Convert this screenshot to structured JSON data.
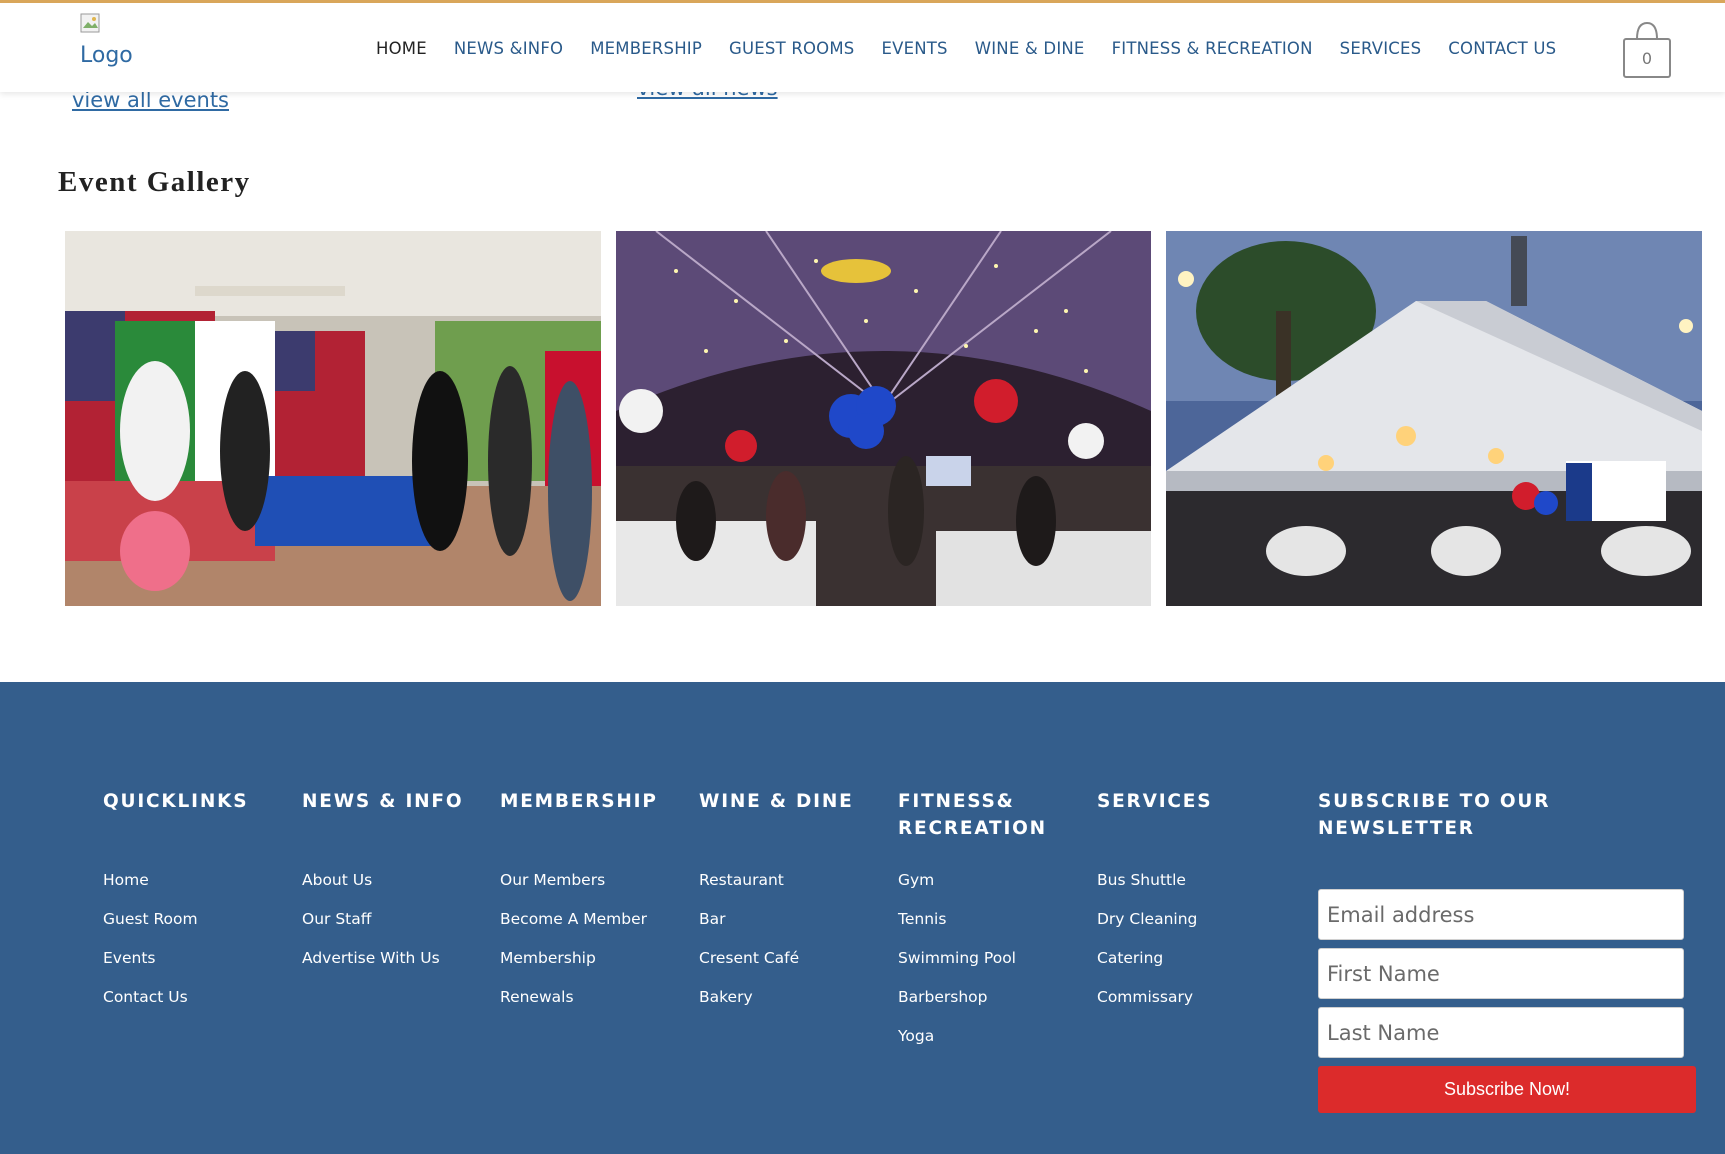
{
  "header": {
    "logo_alt": "Logo",
    "nav": [
      {
        "label": "HOME",
        "active": true
      },
      {
        "label": "NEWS &INFO"
      },
      {
        "label": "MEMBERSHIP"
      },
      {
        "label": "GUEST ROOMS"
      },
      {
        "label": "EVENTS"
      },
      {
        "label": "WINE & DINE"
      },
      {
        "label": "FITNESS & RECREATION"
      },
      {
        "label": "SERVICES"
      },
      {
        "label": "CONTACT US"
      }
    ],
    "cart_count": "0"
  },
  "content": {
    "view_all_events": "view all events",
    "view_all_news": "view all news",
    "gallery_title": "Event Gallery"
  },
  "footer": {
    "columns": [
      {
        "title": "QUICKLINKS",
        "links": [
          "Home",
          "Guest Room",
          "Events",
          "Contact Us"
        ]
      },
      {
        "title": "NEWS & INFO",
        "links": [
          "About Us",
          "Our Staff",
          "Advertise With Us"
        ]
      },
      {
        "title": "MEMBERSHIP",
        "links": [
          "Our Members",
          "Become A Member",
          "Membership",
          "Renewals"
        ]
      },
      {
        "title": "WINE & DINE",
        "links": [
          "Restaurant",
          "Bar",
          "Cresent Café",
          "Bakery"
        ]
      },
      {
        "title": "FITNESS&\nRECREATION",
        "links": [
          "Gym",
          "Tennis",
          "Swimming Pool",
          "Barbershop",
          "Yoga"
        ]
      },
      {
        "title": "SERVICES",
        "links": [
          "Bus Shuttle",
          "Dry Cleaning",
          "Catering",
          "Commissary"
        ]
      }
    ],
    "newsletter": {
      "title": "SUBSCRIBE TO OUR NEWSLETTER",
      "email_placeholder": "Email address",
      "first_name_placeholder": "First Name",
      "last_name_placeholder": "Last Name",
      "button_label": "Subscribe Now!"
    }
  },
  "colors": {
    "footer_bg": "#345e8c",
    "link_blue": "#2f6aa3",
    "button_red": "#dc2b2b",
    "header_top_border": "#d9a65a"
  }
}
